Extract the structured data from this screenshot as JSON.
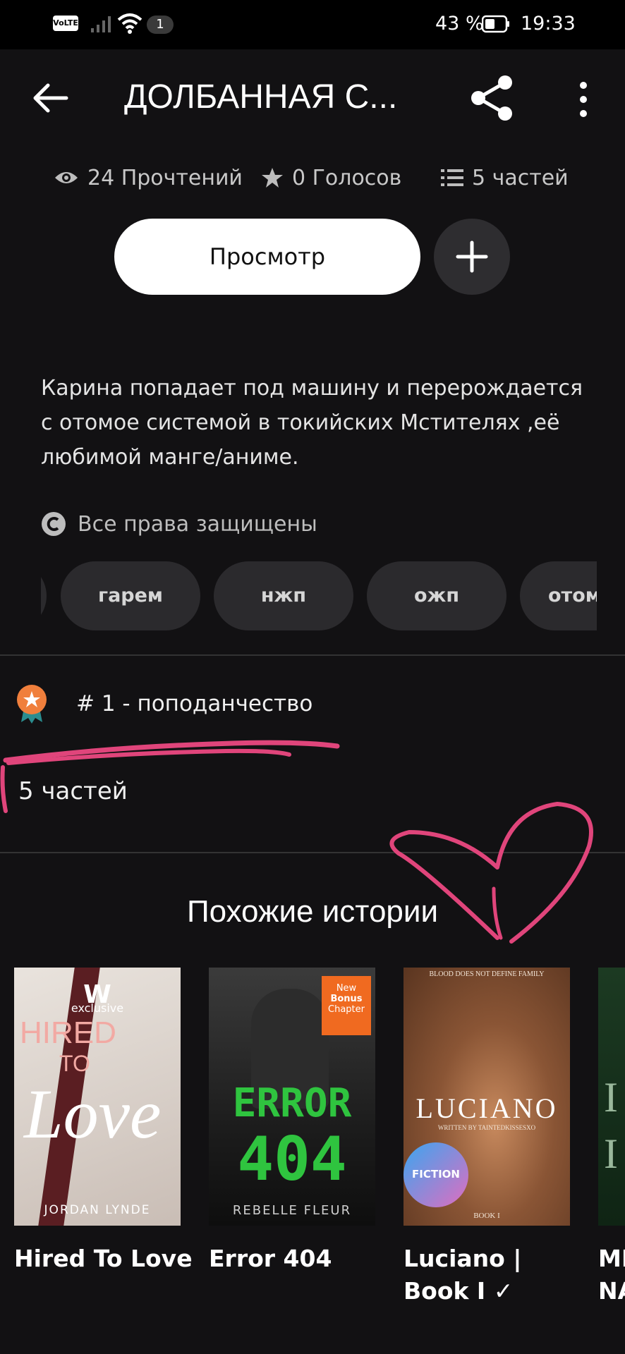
{
  "status_bar": {
    "volte": "VoLTE",
    "badge": "1",
    "battery_percent": "43 %",
    "time": "19:33"
  },
  "header": {
    "title": "ДОЛБАННАЯ С..."
  },
  "stats": {
    "reads": "24 Прочтений",
    "votes": "0 Голосов",
    "parts": "5 частей"
  },
  "actions": {
    "view_label": "Просмотр",
    "add_label": "+"
  },
  "description": "Карина попадает под машину и перерождается с отомое системой в токийских Мстителях ,её любимой манге/аниме.",
  "copyright": "Все права защищены",
  "tags": [
    "",
    "гарем",
    "нжп",
    "ожп",
    "отом"
  ],
  "ranking": {
    "text": "# 1 - поподанчество"
  },
  "parts_summary": "5 частей",
  "similar": {
    "title": "Похожие истории",
    "books": [
      {
        "title": "Hired To Love",
        "cover_lines": [
          "exclusive",
          "HIRED",
          "TO",
          "Love",
          "JORDAN LYNDE"
        ]
      },
      {
        "title": "Error 404",
        "cover_lines": [
          "New",
          "Bonus",
          "Chapter",
          "ERROR",
          "404",
          "REBELLE FLEUR"
        ]
      },
      {
        "title": "Luciano | Book I ✓",
        "cover_lines": [
          "BLOOD DOES NOT DEFINE FAMILY",
          "LUCIANO",
          "WRITTEN BY TAINTEDKISSESXO",
          "FICTION",
          "BOOK I"
        ]
      },
      {
        "title": "MI NA",
        "cover_lines": [
          "I",
          "I"
        ]
      }
    ]
  },
  "colors": {
    "background": "#121113",
    "accent_pink": "#e0457b",
    "badge_orange": "#f07f3c"
  }
}
